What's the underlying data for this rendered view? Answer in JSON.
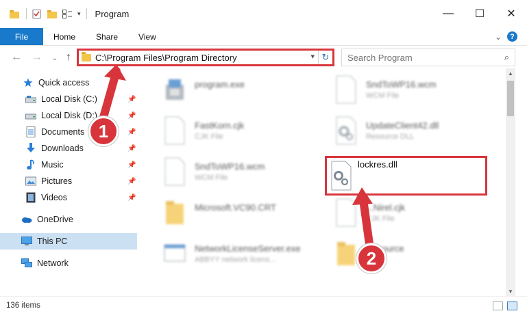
{
  "window": {
    "title": "Program",
    "minimize_glyph": "—",
    "maximize_glyph": "☐",
    "close_glyph": "✕"
  },
  "ribbon": {
    "tabs": [
      "File",
      "Home",
      "Share",
      "View"
    ],
    "expand_glyph": "⌄",
    "help_glyph": "?"
  },
  "nav": {
    "back_glyph": "←",
    "forward_glyph": "→",
    "recent_glyph": "⌄",
    "up_glyph": "↑",
    "address": "C:\\Program Files\\Program Directory",
    "refresh_glyph": "↻",
    "search_placeholder": "Search Program",
    "search_glyph": "⌕"
  },
  "sidebar": {
    "quick_access": "Quick access",
    "items": [
      {
        "label": "Local Disk (C:)",
        "icon": "drive-icon",
        "pinned": true
      },
      {
        "label": "Local Disk (D:)",
        "icon": "drive-icon",
        "pinned": true
      },
      {
        "label": "Documents",
        "icon": "documents-icon",
        "pinned": true
      },
      {
        "label": "Downloads",
        "icon": "downloads-icon",
        "pinned": true
      },
      {
        "label": "Music",
        "icon": "music-icon",
        "pinned": true
      },
      {
        "label": "Pictures",
        "icon": "pictures-icon",
        "pinned": true
      },
      {
        "label": "Videos",
        "icon": "videos-icon",
        "pinned": true
      }
    ],
    "onedrive": "OneDrive",
    "this_pc": "This PC",
    "network": "Network",
    "pin_glyph": "📌"
  },
  "files": [
    {
      "name": "program.exe",
      "type": ""
    },
    {
      "name": "SndToWP16.wcm",
      "type": "WCM File"
    },
    {
      "name": "FastKorn.cjk",
      "type": "CJK File"
    },
    {
      "name": "UpdateClient42.dll",
      "type": "Resource DLL"
    },
    {
      "name": "SndToWP16.wcm",
      "type": "WCM File"
    },
    {
      "name": "lockres.dll",
      "type": ""
    },
    {
      "name": "Microsoft.VC90.CRT",
      "type": ""
    },
    {
      "name": "...Nirel.cjk",
      "type": "CJK File"
    },
    {
      "name": "NetworkLicenseServer.exe",
      "type": "ABBYY network licens..."
    },
    {
      "name": "Resource",
      "type": ""
    }
  ],
  "callouts": [
    "1",
    "2"
  ],
  "status": {
    "item_count": "136 items"
  },
  "colors": {
    "accent": "#1979ca",
    "highlight_red": "#d8343b",
    "selection": "#cce0f3"
  }
}
